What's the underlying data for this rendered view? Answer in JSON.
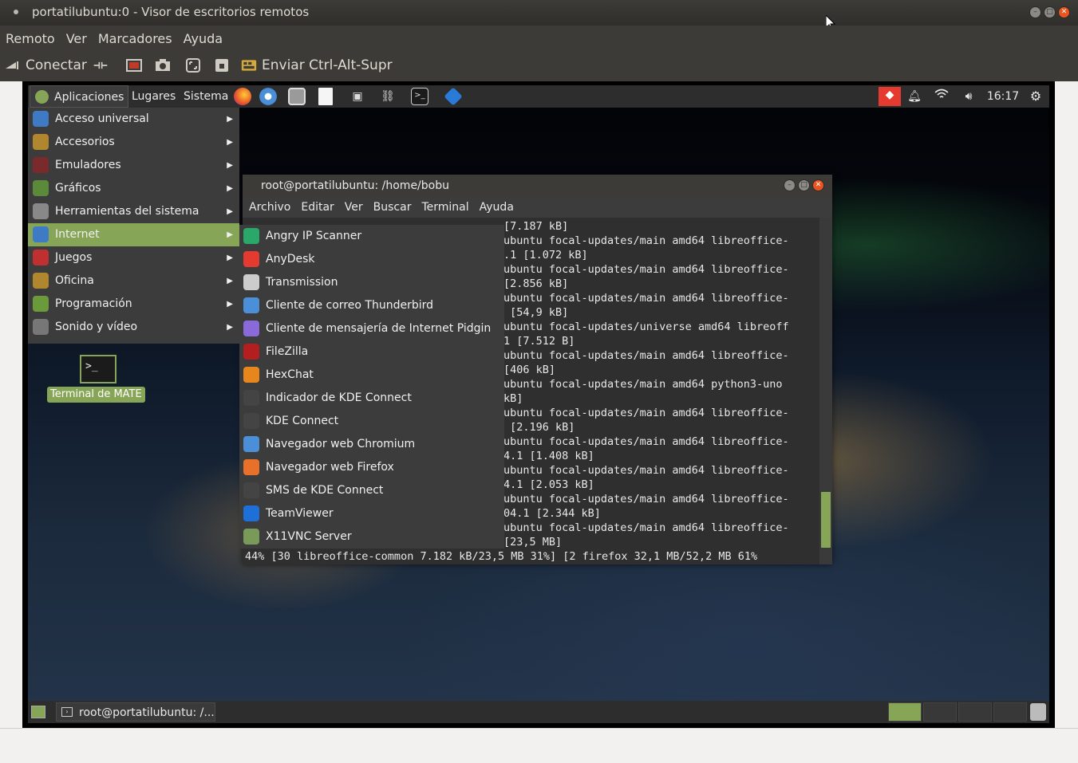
{
  "outer_window": {
    "title": "portatilubuntu:0 - Visor de escritorios remotos",
    "menu": [
      "Remoto",
      "Ver",
      "Marcadores",
      "Ayuda"
    ],
    "toolbar": {
      "connect_label": "Conectar",
      "send_cad_label": "Enviar Ctrl-Alt-Supr"
    }
  },
  "remote": {
    "top_panel": {
      "menus": [
        "Aplicaciones",
        "Lugares",
        "Sistema"
      ],
      "clock": "16:17"
    },
    "apps_menu": [
      {
        "label": "Acceso universal",
        "icon": "accessibility-icon",
        "color": "#3f7bc4"
      },
      {
        "label": "Accesorios",
        "icon": "accessories-icon",
        "color": "#b0872f"
      },
      {
        "label": "Emuladores",
        "icon": "emulators-icon",
        "color": "#7a2a2a"
      },
      {
        "label": "Gráficos",
        "icon": "graphics-icon",
        "color": "#5a8a3a"
      },
      {
        "label": "Herramientas del sistema",
        "icon": "system-tools-icon",
        "color": "#888888"
      },
      {
        "label": "Internet",
        "icon": "internet-icon",
        "color": "#3f7bc4"
      },
      {
        "label": "Juegos",
        "icon": "games-icon",
        "color": "#c03030"
      },
      {
        "label": "Oficina",
        "icon": "office-icon",
        "color": "#b0872f"
      },
      {
        "label": "Programación",
        "icon": "programming-icon",
        "color": "#6a9a3a"
      },
      {
        "label": "Sonido y vídeo",
        "icon": "sound-video-icon",
        "color": "#777777"
      }
    ],
    "internet_submenu": [
      {
        "label": "Angry IP Scanner",
        "icon": "angry-ip-scanner-icon",
        "color": "#2aa86a"
      },
      {
        "label": "AnyDesk",
        "icon": "anydesk-icon",
        "color": "#e43a2f"
      },
      {
        "label": "Transmission",
        "icon": "transmission-icon",
        "color": "#cccccc"
      },
      {
        "label": "Cliente de correo Thunderbird",
        "icon": "thunderbird-icon",
        "color": "#4a8fd8"
      },
      {
        "label": "Cliente de mensajería de Internet Pidgin",
        "icon": "pidgin-icon",
        "color": "#8a6ad8"
      },
      {
        "label": "FileZilla",
        "icon": "filezilla-icon",
        "color": "#b41e1e"
      },
      {
        "label": "HexChat",
        "icon": "hexchat-icon",
        "color": "#e8861e"
      },
      {
        "label": "Indicador de KDE Connect",
        "icon": "kde-connect-indicator-icon",
        "color": "#444444"
      },
      {
        "label": "KDE Connect",
        "icon": "kde-connect-icon",
        "color": "#444444"
      },
      {
        "label": "Navegador web Chromium",
        "icon": "chromium-icon",
        "color": "#4a8fd8"
      },
      {
        "label": "Navegador web Firefox",
        "icon": "firefox-icon",
        "color": "#e8702a"
      },
      {
        "label": "SMS de KDE Connect",
        "icon": "kde-connect-sms-icon",
        "color": "#444444"
      },
      {
        "label": "TeamViewer",
        "icon": "teamviewer-icon",
        "color": "#1e6fd8"
      },
      {
        "label": "X11VNC Server",
        "icon": "x11vnc-icon",
        "color": "#7a9a5a"
      }
    ],
    "desktop_icon_label": "Terminal de MATE",
    "terminal": {
      "title": "root@portatilubuntu: /home/bobu",
      "menu": [
        "Archivo",
        "Editar",
        "Ver",
        "Buscar",
        "Terminal",
        "Ayuda"
      ],
      "lines": [
        "[7.187 kB]",
        "ubuntu focal-updates/main amd64 libreoffice-",
        ".1 [1.072 kB]",
        "ubuntu focal-updates/main amd64 libreoffice-",
        "[2.856 kB]",
        "ubuntu focal-updates/main amd64 libreoffice-",
        " [54,9 kB]",
        "ubuntu focal-updates/universe amd64 libreoff",
        "1 [7.512 B]",
        "ubuntu focal-updates/main amd64 libreoffice-",
        "[406 kB]",
        "ubuntu focal-updates/main amd64 python3-uno",
        "kB]",
        "ubuntu focal-updates/main amd64 libreoffice-",
        " [2.196 kB]",
        "ubuntu focal-updates/main amd64 libreoffice-",
        "4.1 [1.408 kB]",
        "ubuntu focal-updates/main amd64 libreoffice-",
        "4.1 [2.053 kB]",
        "ubuntu focal-updates/main amd64 libreoffice-",
        "04.1 [2.344 kB]",
        "ubuntu focal-updates/main amd64 libreoffice-",
        "[23,5 MB]"
      ],
      "status_line": "44% [30 libreoffice-common 7.182 kB/23,5 MB 31%] [2 firefox 32,1 MB/52,2 MB 61%"
    },
    "taskbar_item": "root@portatilubuntu: /..."
  }
}
